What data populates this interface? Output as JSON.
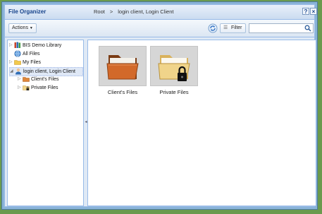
{
  "window": {
    "title": "File Organizer",
    "breadcrumb": {
      "root": "Root",
      "separator": ">",
      "current": "login client, Login Client"
    },
    "help_label": "?",
    "close_label": "×"
  },
  "toolbar": {
    "actions_label": "Actions",
    "filter_label": "Filter",
    "search_placeholder": ""
  },
  "tree": {
    "items": [
      {
        "label": "BIS Demo Library",
        "icon": "library-icon",
        "expander": "▷"
      },
      {
        "label": "All Files",
        "icon": "globe-icon",
        "expander": ""
      },
      {
        "label": "My Files",
        "icon": "folder-icon",
        "expander": "▷"
      },
      {
        "label": "login client, Login Client",
        "icon": "user-icon",
        "expander": "◢"
      },
      {
        "label": "Client's Files",
        "icon": "folder-icon",
        "expander": "▷"
      },
      {
        "label": "Private Files",
        "icon": "locked-folder-icon",
        "expander": "▷"
      }
    ]
  },
  "tiles": [
    {
      "label": "Client's Files",
      "icon": "open-folder-icon"
    },
    {
      "label": "Private Files",
      "icon": "locked-folder-icon"
    }
  ],
  "colors": {
    "accent": "#15428b",
    "panel_border": "#99bbe8",
    "folder_orange": "#d2692a",
    "folder_tan": "#f0d48a"
  }
}
